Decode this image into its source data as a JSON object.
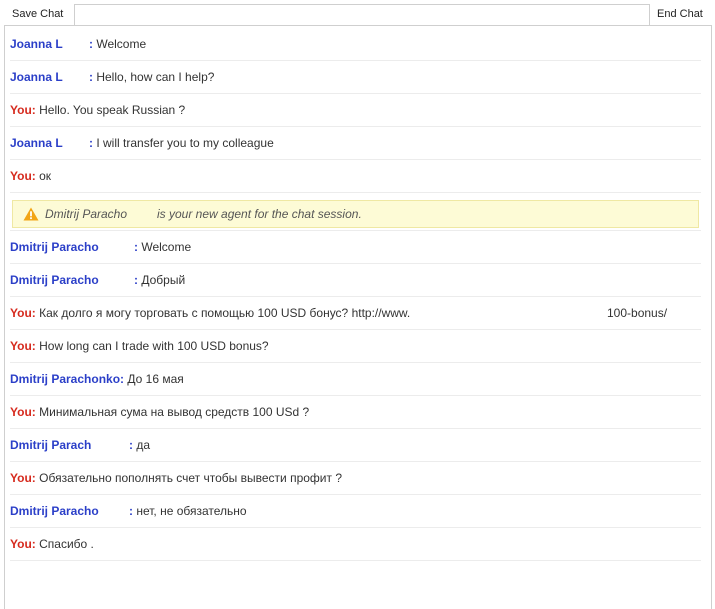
{
  "toolbar": {
    "save_label": "Save Chat",
    "end_label": "End Chat"
  },
  "messages": [
    {
      "sender": "Joanna L",
      "sep": ":",
      "text": "Welcome"
    },
    {
      "sender": "Joanna L",
      "sep": ":",
      "text": "Hello, how can I help?"
    },
    {
      "sender": "You:",
      "text": "Hello. You speak Russian ?"
    },
    {
      "sender": "Joanna L",
      "sep": ":",
      "text": "I will transfer you to my colleague"
    },
    {
      "sender": "You:",
      "text": "ок"
    }
  ],
  "notice": {
    "name": "Dmitrij Paracho",
    "text": "is your new agent for the chat session.",
    "icon": "warning-icon"
  },
  "messages2": [
    {
      "sender": "Dmitrij Paracho",
      "sep": ":",
      "text": "Welcome"
    },
    {
      "sender": "Dmitrij Paracho",
      "sep": ":",
      "text": "Добрый"
    },
    {
      "sender": "You:",
      "text": "Как долго я могу торговать с помощью 100 USD бонус? http://www.",
      "trail": "100-bonus/"
    },
    {
      "sender": "You:",
      "text": "How long can I trade with 100 USD bonus?"
    },
    {
      "sender": "Dmitrij Parachonko:",
      "text": "До 16 мая"
    },
    {
      "sender": "You:",
      "text": "Минимальная сума на вывод средств 100 USd ?"
    },
    {
      "sender": "Dmitrij Parach",
      "sep": ":",
      "text": "да"
    },
    {
      "sender": "You:",
      "text": "Обязательно пополнять счет чтобы вывести профит ?"
    },
    {
      "sender": "Dmitrij Paracho",
      "sep": ":",
      "text": "нет, не обязательно"
    },
    {
      "sender": "You:",
      "text": "Спасибо ."
    }
  ],
  "colors": {
    "agent": "#2b3fc8",
    "user": "#d62a1e",
    "notice_bg": "#fdfbd6"
  }
}
